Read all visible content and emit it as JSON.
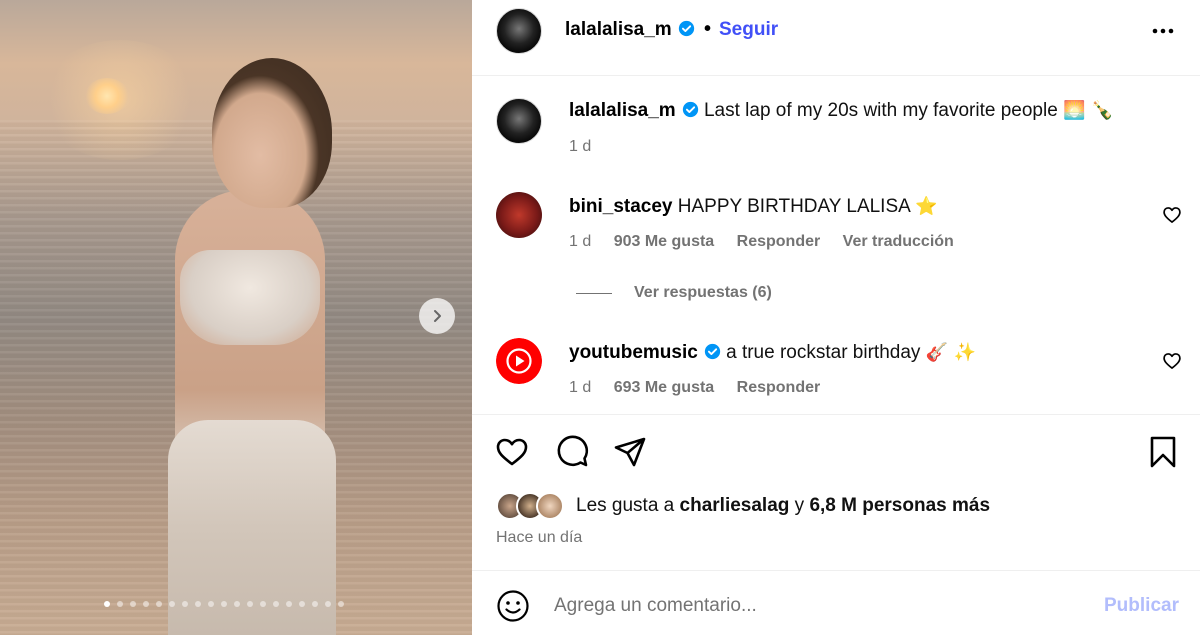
{
  "post": {
    "author": "lalalalisa_m",
    "follow_label": "Seguir",
    "separator": "•",
    "caption_text": "Last lap of my 20s with my favorite people",
    "caption_emoji": "🌅 🍾",
    "caption_time": "1 d",
    "carousel": {
      "count": 19,
      "active_index": 0
    }
  },
  "comments": [
    {
      "username": "bini_stacey",
      "text": "HAPPY BIRTHDAY LALISA",
      "emoji": "⭐",
      "time": "1 d",
      "likes": "903 Me gusta",
      "reply": "Responder",
      "translate": "Ver traducción",
      "view_replies": "Ver respuestas (6)"
    },
    {
      "username": "youtubemusic",
      "text": "a true rockstar birthday",
      "emoji": "🎸 ✨",
      "time": "1 d",
      "likes": "693 Me gusta",
      "reply": "Responder"
    }
  ],
  "likes_summary": {
    "prefix": "Les gusta a",
    "user": "charliesalag",
    "conj": "y",
    "others": "6,8 M personas más"
  },
  "posted_ago": "Hace un día",
  "composer": {
    "placeholder": "Agrega un comentario...",
    "post_label": "Publicar"
  },
  "colors": {
    "accent": "#4150f7",
    "verified": "#0095f6",
    "muted": "#737373",
    "post_disabled": "#b2bdfc"
  },
  "icons": [
    "more-icon",
    "heart-icon",
    "comment-icon",
    "share-icon",
    "bookmark-icon",
    "emoji-icon",
    "verified-icon",
    "chevron-right-icon"
  ]
}
